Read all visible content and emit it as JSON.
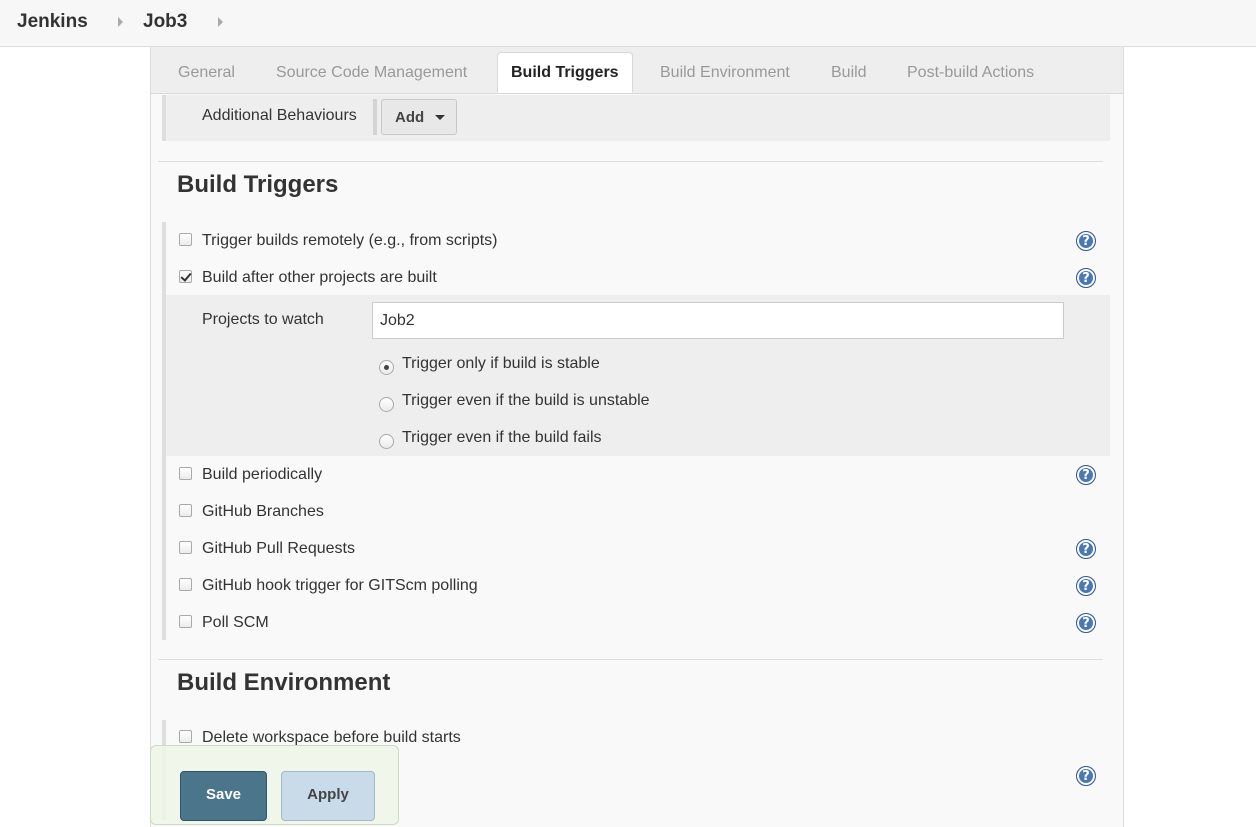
{
  "breadcrumb": {
    "items": [
      "Jenkins",
      "Job3"
    ]
  },
  "tabs": [
    {
      "label": "General"
    },
    {
      "label": "Source Code Management"
    },
    {
      "label": "Build Triggers",
      "active": true
    },
    {
      "label": "Build Environment"
    },
    {
      "label": "Build"
    },
    {
      "label": "Post-build Actions"
    }
  ],
  "scm": {
    "additional_behaviours_label": "Additional Behaviours",
    "add_button_label": "Add"
  },
  "build_triggers": {
    "heading": "Build Triggers",
    "options": [
      {
        "label": "Trigger builds remotely (e.g., from scripts)",
        "checked": false,
        "has_help": true
      },
      {
        "label": "Build after other projects are built",
        "checked": true,
        "has_help": true
      },
      {
        "label": "Build periodically",
        "checked": false,
        "has_help": true
      },
      {
        "label": "GitHub Branches",
        "checked": false,
        "has_help": false
      },
      {
        "label": "GitHub Pull Requests",
        "checked": false,
        "has_help": true
      },
      {
        "label": "GitHub hook trigger for GITScm polling",
        "checked": false,
        "has_help": true
      },
      {
        "label": "Poll SCM",
        "checked": false,
        "has_help": true
      }
    ],
    "projects_to_watch": {
      "label": "Projects to watch",
      "value": "Job2"
    },
    "radio_options": [
      {
        "label": "Trigger only if build is stable",
        "selected": true
      },
      {
        "label": "Trigger even if the build is unstable",
        "selected": false
      },
      {
        "label": "Trigger even if the build fails",
        "selected": false
      }
    ]
  },
  "build_environment": {
    "heading": "Build Environment",
    "options": [
      {
        "label": "Delete workspace before build starts",
        "checked": false
      }
    ]
  },
  "actions": {
    "save_label": "Save",
    "apply_label": "Apply"
  },
  "colors": {
    "help_icon": "#4a78b5",
    "save_button": "#4b758b",
    "apply_button": "#c9dbe9"
  }
}
